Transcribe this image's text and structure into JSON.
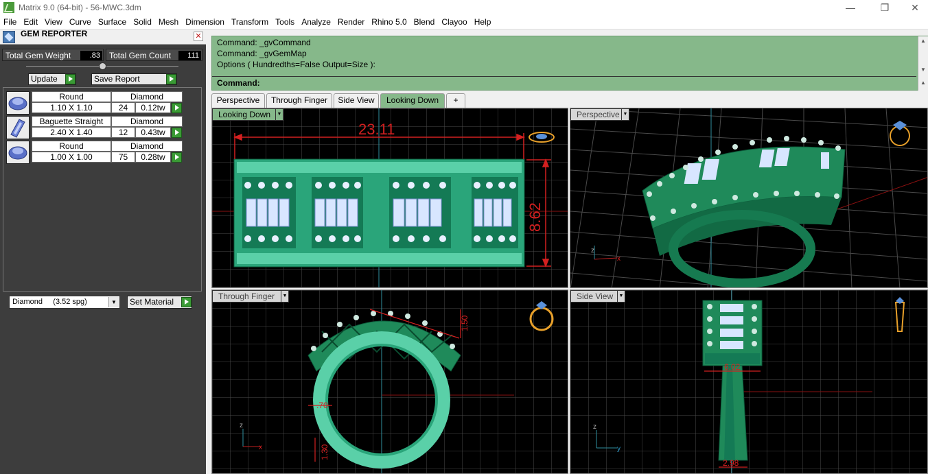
{
  "window": {
    "title": "Matrix 9.0 (64-bit) - 56-MWC.3dm",
    "controls": [
      "—",
      "❐",
      "✕"
    ]
  },
  "menu": [
    "File",
    "Edit",
    "View",
    "Curve",
    "Surface",
    "Solid",
    "Mesh",
    "Dimension",
    "Transform",
    "Tools",
    "Analyze",
    "Render",
    "Rhino 5.0",
    "Blend",
    "Clayoo",
    "Help"
  ],
  "gem_reporter": {
    "title": "GEM REPORTER",
    "close": "✕",
    "total_weight_label": "Total Gem Weight",
    "total_weight_value": ".83",
    "total_count_label": "Total Gem Count",
    "total_count_value": "111",
    "update_label": "Update",
    "save_report_label": "Save Report",
    "gems": [
      {
        "shape": "Round",
        "material": "Diamond",
        "size": "1.10 X 1.10",
        "count": "24",
        "weight": "0.12tw",
        "icon": "round-gem-icon"
      },
      {
        "shape": "Baguette Straight",
        "material": "Diamond",
        "size": "2.40 X 1.40",
        "count": "12",
        "weight": "0.43tw",
        "icon": "baguette-gem-icon"
      },
      {
        "shape": "Round",
        "material": "Diamond",
        "size": "1.00 X 1.00",
        "count": "75",
        "weight": "0.28tw",
        "icon": "round-gem-icon"
      }
    ],
    "material_value": "Diamond     (3.52 spg)",
    "set_material_label": "Set Material"
  },
  "command": {
    "lines": [
      "Command: _gvCommand",
      "Command: _gvGemMap",
      "Options ( Hundredths=False  Output=Size ):"
    ],
    "prompt": "Command:"
  },
  "tabs": [
    "Perspective",
    "Through Finger",
    "Side View",
    "Looking Down",
    "+"
  ],
  "active_tab": "Looking Down",
  "viewports": {
    "top_left": {
      "label": "Looking Down",
      "dim_width": "23.11",
      "dim_height": "8.62"
    },
    "top_right": {
      "label": "Perspective",
      "axis_z": "z",
      "axis_x": "x"
    },
    "bottom_left": {
      "label": "Through Finger",
      "dim_a": "1.50",
      "dim_b": ".70",
      "dim_c": "1.30",
      "axis_z": "z",
      "axis_x": "x"
    },
    "bottom_right": {
      "label": "Side View",
      "dim_a": "6.02",
      "dim_b": "2.98",
      "axis_z": "z",
      "axis_y": "y"
    }
  },
  "colors": {
    "command_bg": "#86b88a",
    "ring_green": "#1f8a5a",
    "dimension_red": "#d42020",
    "grid": "#5a5a5a"
  }
}
